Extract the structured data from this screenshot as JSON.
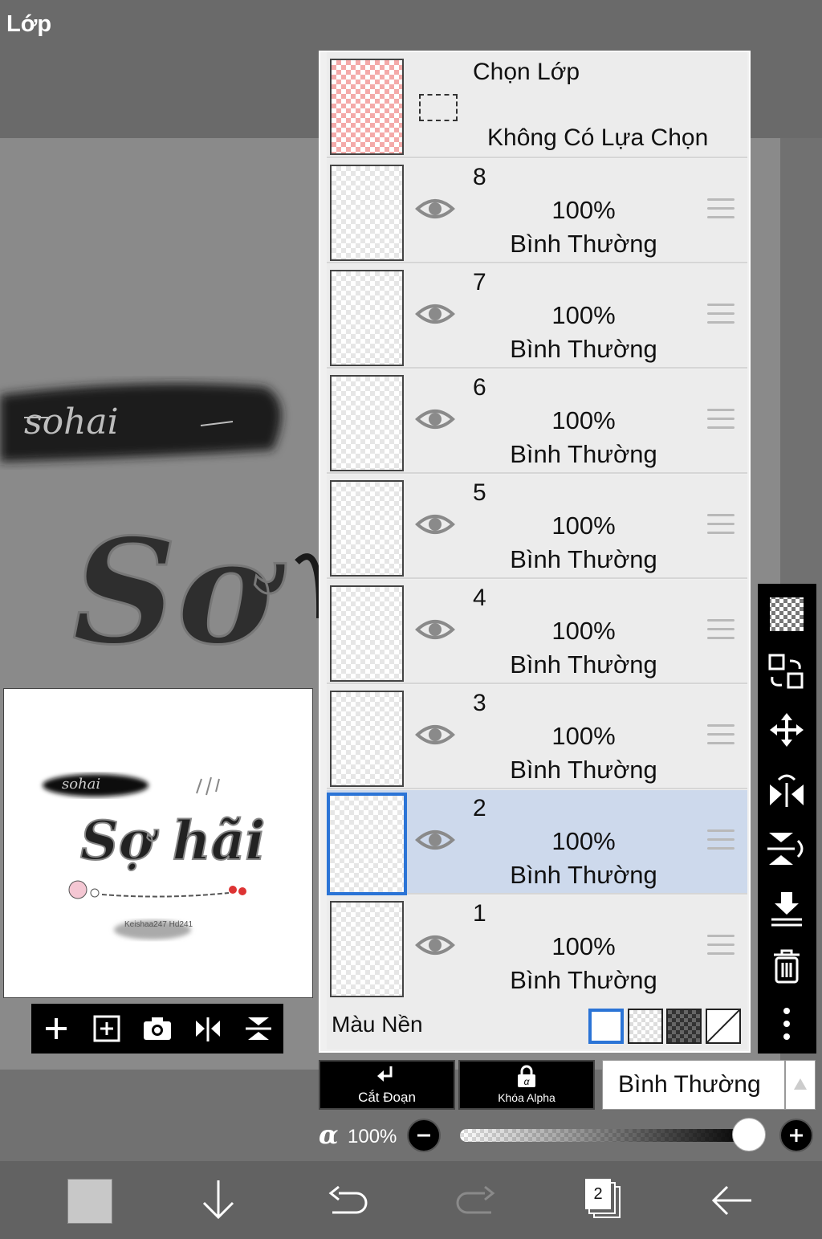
{
  "window": {
    "title": "Lớp"
  },
  "selection": {
    "title": "Chọn Lớp",
    "status": "Không Có Lựa Chọn"
  },
  "layers": [
    {
      "number": "8",
      "opacity": "100%",
      "blend": "Bình Thường",
      "selected": false
    },
    {
      "number": "7",
      "opacity": "100%",
      "blend": "Bình Thường",
      "selected": false
    },
    {
      "number": "6",
      "opacity": "100%",
      "blend": "Bình Thường",
      "selected": false
    },
    {
      "number": "5",
      "opacity": "100%",
      "blend": "Bình Thường",
      "selected": false
    },
    {
      "number": "4",
      "opacity": "100%",
      "blend": "Bình Thường",
      "selected": false
    },
    {
      "number": "3",
      "opacity": "100%",
      "blend": "Bình Thường",
      "selected": false
    },
    {
      "number": "2",
      "opacity": "100%",
      "blend": "Bình Thường",
      "selected": true
    },
    {
      "number": "1",
      "opacity": "100%",
      "blend": "Bình Thường",
      "selected": false
    }
  ],
  "background": {
    "label": "Màu Nền",
    "options": [
      "white",
      "checker",
      "dark-checker",
      "none"
    ],
    "selected": "white"
  },
  "controls": {
    "clip_label": "Cắt Đoạn",
    "alpha_lock_label": "Khóa Alpha",
    "blend_mode": "Bình Thường",
    "alpha_symbol": "α",
    "alpha_value": "100%",
    "alpha_fraction": 1.0
  },
  "artwork": {
    "banner_text": "sohai",
    "title_text": "Sợ hãi",
    "credit_text": "Keishaa247 Hd241"
  },
  "bottom_bar": {
    "layer_count": "2"
  },
  "colors": {
    "selected_row": "#cdd9ec",
    "accent": "#2b74d6"
  },
  "right_toolbar": [
    "checker-icon",
    "transfer-icon",
    "move-icon",
    "flip-horizontal-icon",
    "flip-vertical-icon",
    "merge-down-icon",
    "trash-icon",
    "more-icon"
  ]
}
